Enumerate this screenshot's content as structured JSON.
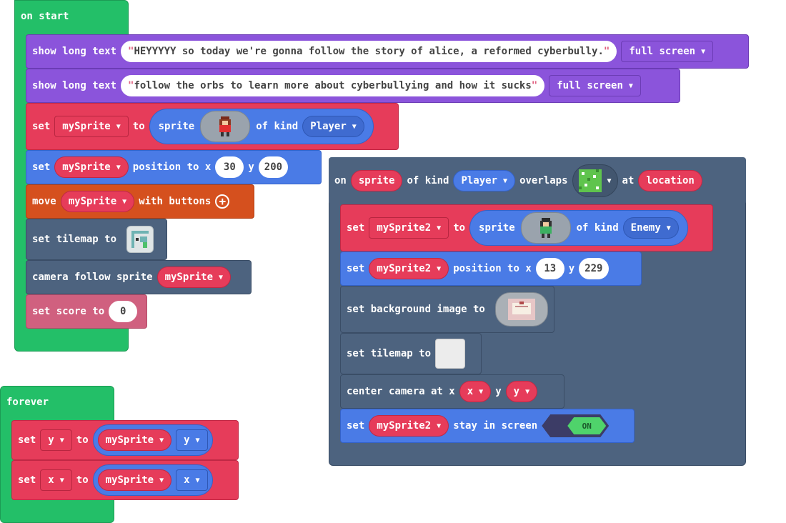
{
  "on_start": {
    "title": "on start",
    "show_text_1": {
      "label": "show long text",
      "text": "HEYYYYY so today we're gonna follow the story of alice, a reformed cyberbully.",
      "mode": "full screen"
    },
    "show_text_2": {
      "label": "show long text",
      "text": "follow the orbs to learn more about cyberbullying and how it sucks ",
      "mode": "full screen"
    },
    "set_sprite": {
      "label_set": "set",
      "var": "mySprite",
      "label_to": "to",
      "label_sprite": "sprite",
      "label_kind": "of kind",
      "kind": "Player"
    },
    "set_position": {
      "label_set": "set",
      "var": "mySprite",
      "label_pos": "position to x",
      "x": "30",
      "label_y": "y",
      "y": "200"
    },
    "move": {
      "label_move": "move",
      "var": "mySprite",
      "label_with": "with buttons"
    },
    "set_tilemap": {
      "label": "set tilemap to"
    },
    "camera": {
      "label": "camera follow sprite",
      "var": "mySprite"
    },
    "score": {
      "label": "set score to",
      "value": "0"
    }
  },
  "forever": {
    "title": "forever",
    "set_y": {
      "label_set": "set",
      "var": "y",
      "label_to": "to",
      "sprite": "mySprite",
      "prop": "y"
    },
    "set_x": {
      "label_set": "set",
      "var": "x",
      "label_to": "to",
      "sprite": "mySprite",
      "prop": "x"
    }
  },
  "overlap": {
    "label_on": "on",
    "sprite_var": "sprite",
    "label_kind": "of kind",
    "kind": "Player",
    "label_overlaps": "overlaps",
    "label_at": "at",
    "location_var": "location",
    "set_sprite2": {
      "label_set": "set",
      "var": "mySprite2",
      "label_to": "to",
      "label_sprite": "sprite",
      "label_kind": "of kind",
      "kind": "Enemy"
    },
    "set_position2": {
      "label_set": "set",
      "var": "mySprite2",
      "label_pos": "position to x",
      "x": "13",
      "label_y": "y",
      "y": "229"
    },
    "background": {
      "label": "set background image to"
    },
    "tilemap2": {
      "label": "set tilemap to"
    },
    "center_camera": {
      "label": "center camera at x",
      "x_var": "x",
      "label_y": "y",
      "y_var": "y"
    },
    "stay": {
      "label_set": "set",
      "var": "mySprite2",
      "label_stay": "stay in screen",
      "toggle": "ON"
    }
  },
  "colors": {
    "event_green": "#23bf68",
    "text_purple": "#8b54db",
    "sprites_red": "#e63c5a",
    "sprites_blue": "#4a7be6",
    "controller_orange": "#d5501e",
    "scene_slate": "#4d637f",
    "info_pink": "#d0607f"
  }
}
